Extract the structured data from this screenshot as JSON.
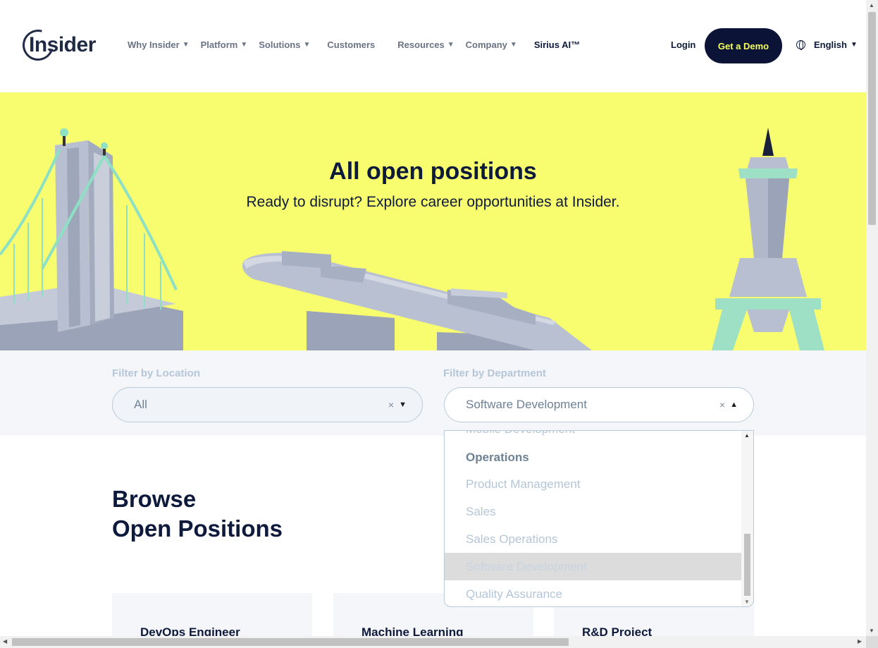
{
  "header": {
    "logo": "Insider",
    "nav": [
      {
        "label": "Why Insider",
        "caret": "▼"
      },
      {
        "label": "Platform",
        "caret": "▼"
      },
      {
        "label": "Solutions",
        "caret": "▼"
      },
      {
        "label": "Customers",
        "caret": ""
      },
      {
        "label": "Resources",
        "caret": "▼"
      },
      {
        "label": "Company",
        "caret": "▼"
      },
      {
        "label": "Sirius AI™",
        "caret": ""
      }
    ],
    "login": "Login",
    "demo": "Get a Demo",
    "language": "English",
    "language_caret": "▼"
  },
  "hero": {
    "title": "All open positions",
    "subtitle": "Ready to disrupt? Explore career opportunities at Insider."
  },
  "filters": {
    "location": {
      "label": "Filter by Location",
      "value": "All",
      "clear": "×",
      "arrow": "▼"
    },
    "department": {
      "label": "Filter by Department",
      "value": "Software Development",
      "clear": "×",
      "arrow": "▲"
    }
  },
  "dropdown": {
    "options": [
      {
        "label": "Mobile Development",
        "style": "partial"
      },
      {
        "label": "Operations",
        "style": "bold"
      },
      {
        "label": "Product Management",
        "style": "normal"
      },
      {
        "label": "Sales",
        "style": "normal"
      },
      {
        "label": "Sales Operations",
        "style": "normal"
      },
      {
        "label": "Software Development",
        "style": "selected"
      },
      {
        "label": "Quality Assurance",
        "style": "normal"
      }
    ]
  },
  "browse": {
    "line1": "Browse",
    "line2": "Open Positions"
  },
  "cards": [
    {
      "title": "DevOps Engineer"
    },
    {
      "title": "Machine Learning"
    },
    {
      "title": "R&D Project"
    }
  ],
  "colors": {
    "hero_bg": "#f7fd6f",
    "navy": "#0b1437",
    "accent_yellow": "#f5ff5a"
  }
}
